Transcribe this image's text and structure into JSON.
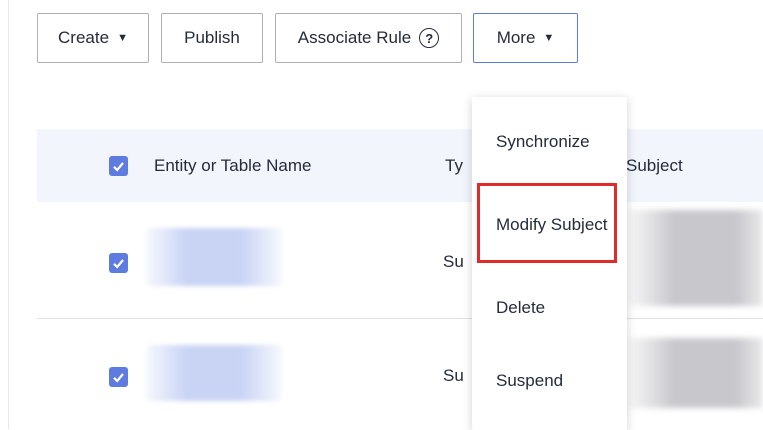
{
  "toolbar": {
    "create_label": "Create",
    "publish_label": "Publish",
    "associate_rule_label": "Associate Rule",
    "help_glyph": "?",
    "more_label": "More",
    "caret_glyph": "▼"
  },
  "table": {
    "columns": {
      "name": "Entity or Table Name",
      "type_fragment": "Ty",
      "subject_fragment": "Subject"
    },
    "rows": [
      {
        "type_fragment": "Su"
      },
      {
        "type_fragment": "Su"
      }
    ]
  },
  "more_menu": {
    "items": [
      "Synchronize",
      "Modify Subject",
      "Delete",
      "Suspend"
    ],
    "highlighted_item": "Modify Subject"
  },
  "colors": {
    "accent": "#5e7ce0",
    "highlight_border": "#e02b2b",
    "header_bg": "#f2f5fc"
  }
}
